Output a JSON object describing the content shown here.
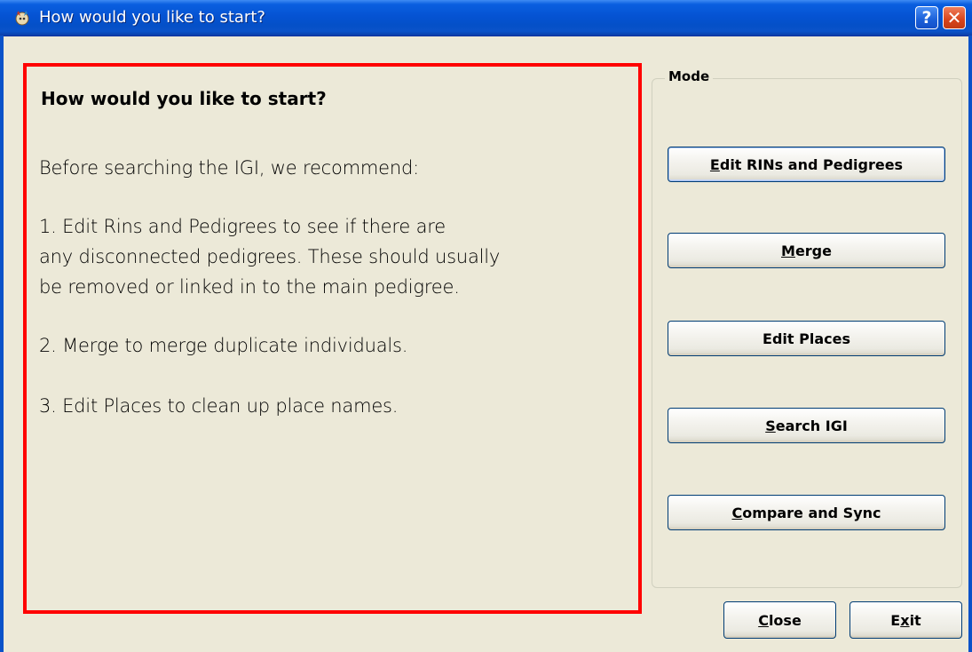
{
  "window": {
    "title": "How would you like to start?",
    "help_button": "?",
    "close_button": "✕"
  },
  "info": {
    "heading": "How would you like to start?",
    "lines": [
      "Before searching the IGI, we recommend:",
      "1. Edit Rins and Pedigrees to see if there are",
      "any disconnected pedigrees. These should usually",
      "be removed or linked in to the main pedigree.",
      "2. Merge to merge duplicate individuals.",
      "3. Edit Places to clean up place names."
    ]
  },
  "mode": {
    "legend": "Mode",
    "buttons": [
      {
        "mnemonic": "E",
        "rest": "dit RINs and Pedigrees"
      },
      {
        "mnemonic": "M",
        "rest": "erge"
      },
      {
        "pre": "Edit Places"
      },
      {
        "mnemonic": "S",
        "rest": "earch IGI"
      },
      {
        "mnemonic": "C",
        "rest": "ompare and Sync"
      }
    ]
  },
  "footer": {
    "close": {
      "mnemonic": "C",
      "rest": "lose"
    },
    "exit": {
      "pre": "E",
      "mnemonic": "x",
      "rest": "it"
    }
  }
}
